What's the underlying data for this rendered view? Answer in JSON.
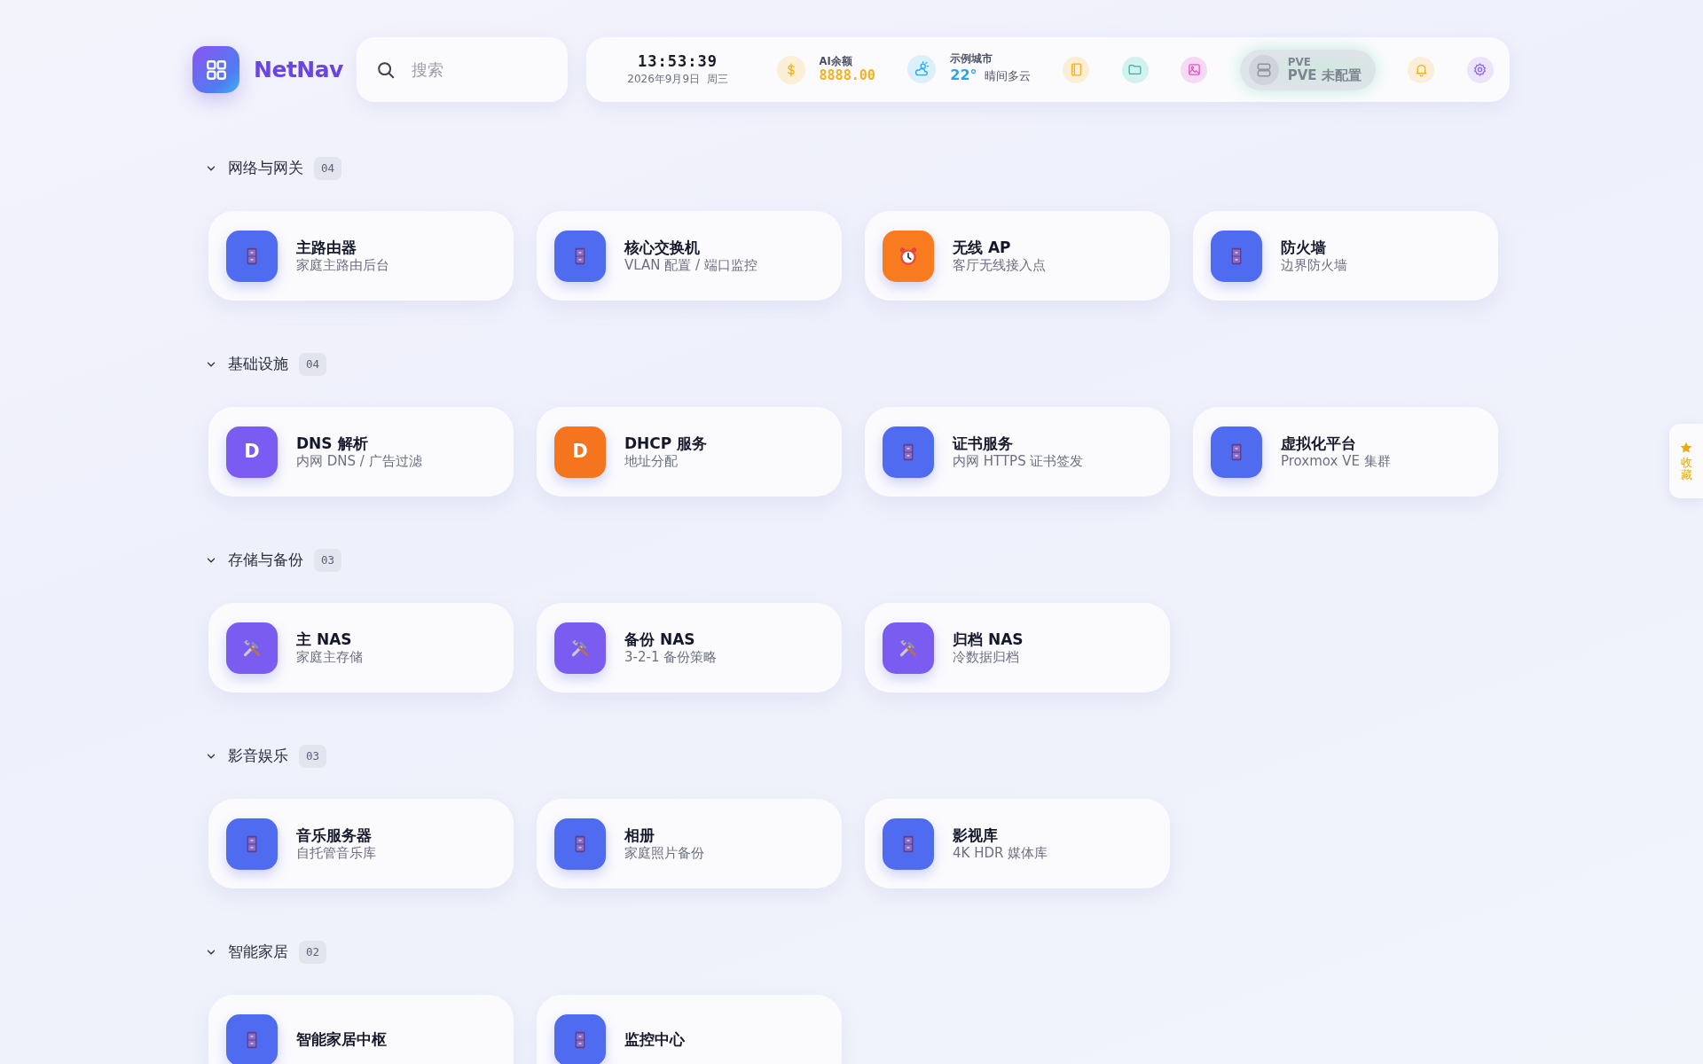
{
  "brand": {
    "name": "NetNav"
  },
  "search": {
    "placeholder": "搜索"
  },
  "clock": {
    "time": "13:53:39",
    "date": "2026年9月9日  周三"
  },
  "balance": {
    "label": "AI余额",
    "amount": "8888.00"
  },
  "weather": {
    "city": "示例城市",
    "temp": "22°",
    "condition": "晴间多云"
  },
  "toolbar": [
    {
      "kind": "notebook"
    },
    {
      "kind": "folder"
    },
    {
      "kind": "image"
    },
    {
      "kind": "pve",
      "label": "PVE",
      "status": "PVE 未配置"
    },
    {
      "kind": "bell"
    },
    {
      "kind": "gear"
    }
  ],
  "sections": [
    {
      "title": "网络与网关",
      "count": "04",
      "expanded": true,
      "cards": [
        {
          "kind": "cabinet",
          "color": "#4f6bef",
          "title": "主路由器",
          "subtitle": "家庭主路由后台"
        },
        {
          "kind": "cabinet",
          "color": "#4f6bef",
          "title": "核心交换机",
          "subtitle": "VLAN 配置 / 端口监控"
        },
        {
          "kind": "alarm",
          "color": "#f97b1f",
          "title": "无线 AP",
          "subtitle": "客厅无线接入点"
        },
        {
          "kind": "cabinet",
          "color": "#4f6bef",
          "title": "防火墙",
          "subtitle": "边界防火墙"
        }
      ]
    },
    {
      "title": "基础设施",
      "count": "04",
      "expanded": true,
      "cards": [
        {
          "kind": "letter",
          "letter": "D",
          "color": "#7b5cf2",
          "title": "DNS 解析",
          "subtitle": "内网 DNS / 广告过滤"
        },
        {
          "kind": "letter",
          "letter": "D",
          "color": "#f5751f",
          "title": "DHCP 服务",
          "subtitle": "地址分配"
        },
        {
          "kind": "cabinet",
          "color": "#4f6bef",
          "title": "证书服务",
          "subtitle": "内网 HTTPS 证书签发"
        },
        {
          "kind": "cabinet",
          "color": "#4f6bef",
          "title": "虚拟化平台",
          "subtitle": "Proxmox VE 集群"
        }
      ]
    },
    {
      "title": "存储与备份",
      "count": "03",
      "expanded": true,
      "cards": [
        {
          "kind": "tools",
          "color": "#7a5cf0",
          "title": "主 NAS",
          "subtitle": "家庭主存储"
        },
        {
          "kind": "tools",
          "color": "#7a5cf0",
          "title": "备份 NAS",
          "subtitle": "3-2-1 备份策略"
        },
        {
          "kind": "tools",
          "color": "#7a5cf0",
          "title": "归档 NAS",
          "subtitle": "冷数据归档"
        }
      ]
    },
    {
      "title": "影音娱乐",
      "count": "03",
      "expanded": true,
      "cards": [
        {
          "kind": "cabinet",
          "color": "#4f6bef",
          "title": "音乐服务器",
          "subtitle": "自托管音乐库"
        },
        {
          "kind": "cabinet",
          "color": "#4f6bef",
          "title": "相册",
          "subtitle": "家庭照片备份"
        },
        {
          "kind": "cabinet",
          "color": "#4f6bef",
          "title": "影视库",
          "subtitle": "4K HDR 媒体库"
        }
      ]
    },
    {
      "title": "智能家居",
      "count": "02",
      "expanded": true,
      "cards": [
        {
          "kind": "cabinet",
          "color": "#4f6bef",
          "title": "智能家居中枢"
        },
        {
          "kind": "cabinet",
          "color": "#4f6bef",
          "title": "监控中心"
        }
      ]
    }
  ],
  "favorites_tab": {
    "label": "收藏"
  }
}
